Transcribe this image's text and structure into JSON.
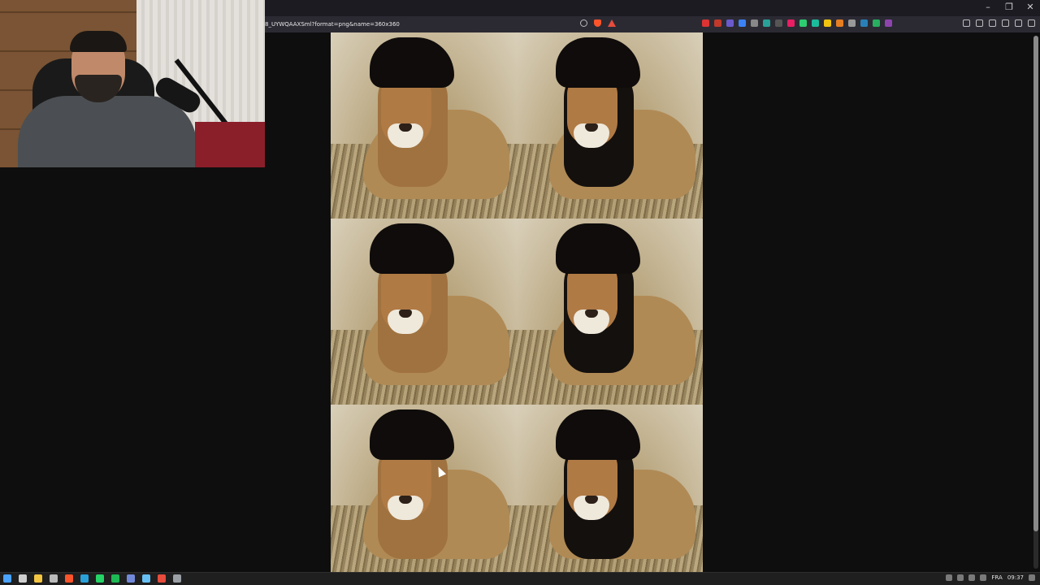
{
  "window": {
    "controls": {
      "minimize": "–",
      "restore": "❐",
      "close": "✕"
    }
  },
  "browser": {
    "url": "8_UYWQAAXSml?format=png&name=360x360",
    "url_icons": [
      "zoom-icon",
      "brave-shield-icon",
      "rewards-icon"
    ],
    "extension_icons": [
      {
        "name": "ext-new-icon",
        "color": "#d33"
      },
      {
        "name": "ext-red-icon",
        "color": "#c0392b"
      },
      {
        "name": "ext-purple-icon",
        "color": "#6a5acd"
      },
      {
        "name": "ext-blue-icon",
        "color": "#3b82f6"
      },
      {
        "name": "ext-gray-icon",
        "color": "#888"
      },
      {
        "name": "ext-teal-icon",
        "color": "#2aa198"
      },
      {
        "name": "ext-dark-icon",
        "color": "#555"
      },
      {
        "name": "ext-pink-icon",
        "color": "#e91e63"
      },
      {
        "name": "ext-green-icon",
        "color": "#2ecc71"
      },
      {
        "name": "ext-cyan-icon",
        "color": "#1abc9c"
      },
      {
        "name": "ext-yellow-icon",
        "color": "#f1c40f"
      },
      {
        "name": "ext-orange-icon",
        "color": "#e67e22"
      },
      {
        "name": "ext-lightgray-icon",
        "color": "#999"
      },
      {
        "name": "ext-blue2-icon",
        "color": "#2980b9"
      },
      {
        "name": "ext-green2-icon",
        "color": "#27ae60"
      },
      {
        "name": "ext-violet-icon",
        "color": "#8e44ad"
      }
    ]
  },
  "grid": {
    "tiles": [
      {
        "name": "lion-hair-tile-1",
        "mane": "light"
      },
      {
        "name": "lion-hair-tile-2",
        "mane": "dark"
      },
      {
        "name": "lion-hair-tile-3",
        "mane": "light"
      },
      {
        "name": "lion-hair-tile-4",
        "mane": "dark"
      },
      {
        "name": "lion-hair-tile-5",
        "mane": "light"
      },
      {
        "name": "lion-hair-tile-6",
        "mane": "dark"
      }
    ]
  },
  "taskbar": {
    "apps": [
      {
        "name": "start-icon",
        "color": "#4aa3ff"
      },
      {
        "name": "search-icon",
        "color": "#cfcfcf"
      },
      {
        "name": "file-explorer-icon",
        "color": "#f4c542"
      },
      {
        "name": "notes-icon",
        "color": "#bbbbbb"
      },
      {
        "name": "brave-icon",
        "color": "#fb542b"
      },
      {
        "name": "edge-icon",
        "color": "#2aa0d8"
      },
      {
        "name": "whatsapp-icon",
        "color": "#25d366"
      },
      {
        "name": "spotify-icon",
        "color": "#1db954"
      },
      {
        "name": "discord-icon",
        "color": "#7289da"
      },
      {
        "name": "steam-icon",
        "color": "#66c0f4"
      },
      {
        "name": "red-app-icon",
        "color": "#e74c3c"
      },
      {
        "name": "settings-icon",
        "color": "#9aa0a6"
      }
    ],
    "language": "FRA",
    "time": "09:37"
  }
}
